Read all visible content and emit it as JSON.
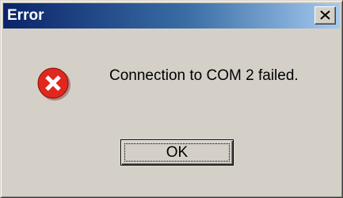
{
  "window": {
    "title": "Error",
    "close_icon": "close-icon"
  },
  "dialog": {
    "icon": "error-icon",
    "message": "Connection to COM 2 failed.",
    "ok_label": "OK"
  },
  "colors": {
    "titlebar_start": "#0a246a",
    "titlebar_end": "#a6caf0",
    "dialog_face": "#d4d0c8",
    "error_red": "#e0281e"
  }
}
